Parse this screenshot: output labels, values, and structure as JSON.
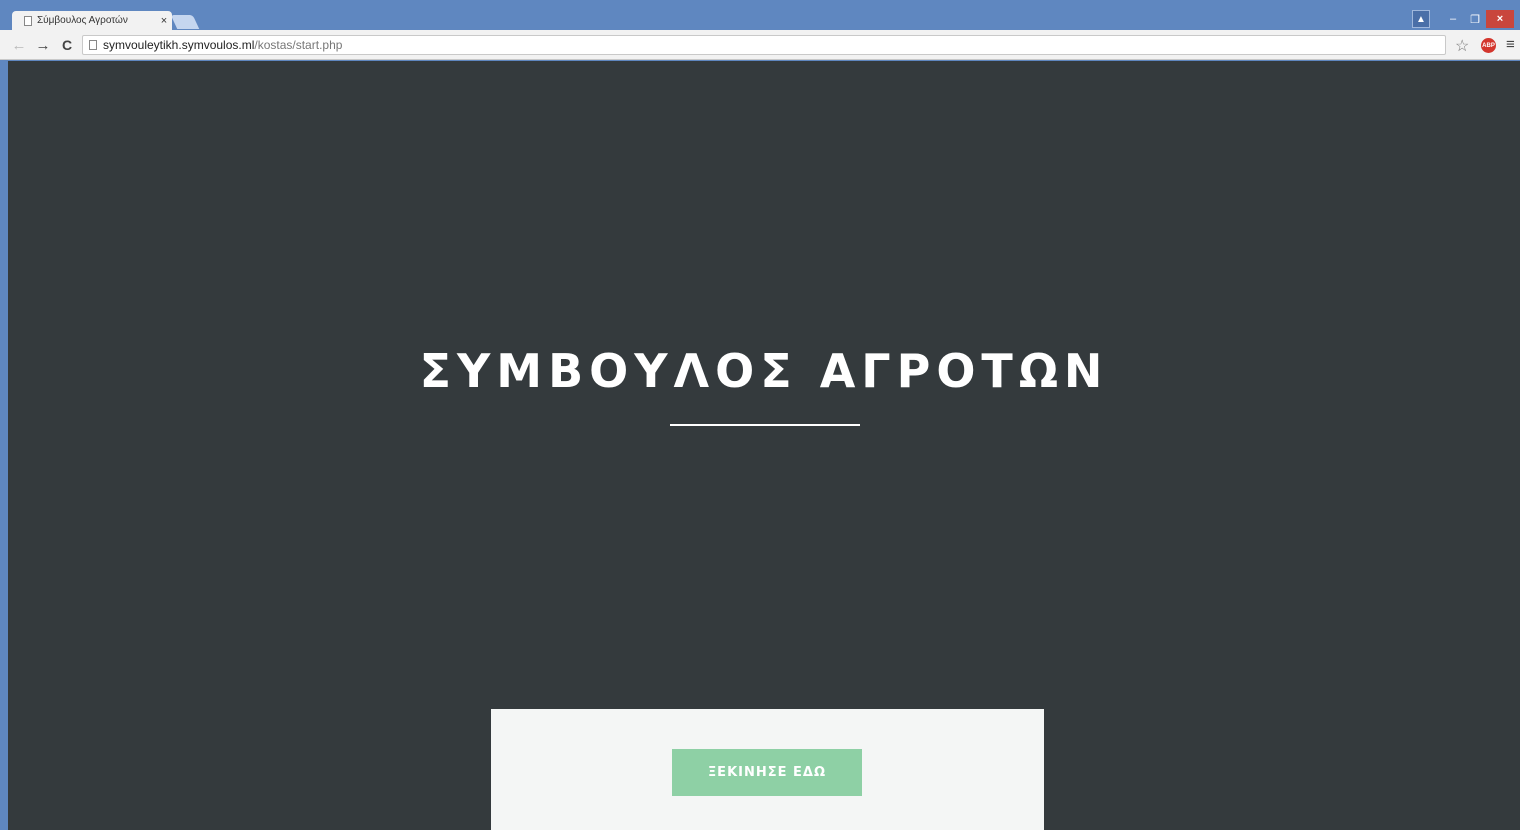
{
  "browser": {
    "tab": {
      "title": "Σύμβουλος Αγροτών",
      "close_glyph": "×"
    },
    "window_controls": {
      "user_glyph": "▲",
      "minimize_glyph": "–",
      "restore_glyph": "❐",
      "close_glyph": "×"
    },
    "toolbar": {
      "back_glyph": "←",
      "forward_glyph": "→",
      "reload_glyph": "C",
      "url_host": "symvouleytikh.symvoulos.ml",
      "url_path": "/kostas/start.php",
      "star_glyph": "☆",
      "abp_label": "ABP",
      "menu_glyph": "≡"
    }
  },
  "page": {
    "hero_title": "ΣΥΜΒΟΥΛΟΣ ΑΓΡΟΤΩΝ",
    "start_button_label": "ΞΕΚΙΝΗΣΕ ΕΔΩ",
    "colors": {
      "background": "#343a3d",
      "card": "#f4f6f5",
      "button": "#8ed0a5",
      "title": "#ffffff"
    }
  }
}
